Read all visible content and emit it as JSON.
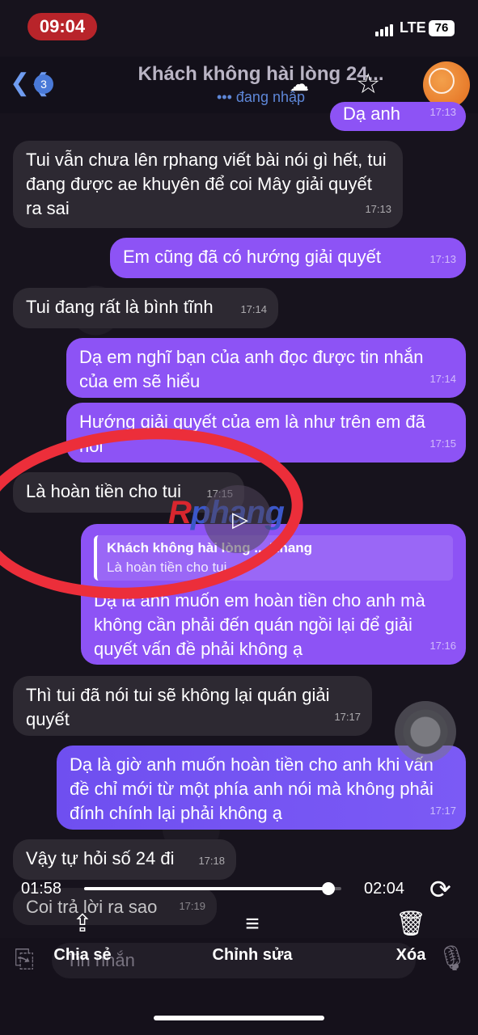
{
  "status_bar": {
    "time": "09:04",
    "network": "LTE",
    "battery": "76"
  },
  "header": {
    "back_count": "3",
    "title": "Khách không hài lòng 24...",
    "status": "đang nhập"
  },
  "messages": [
    {
      "text": "Dạ anh",
      "time": "17:13"
    },
    {
      "text": "Tui vẫn chưa lên rphang viết bài nói gì hết, tui đang được ae khuyên để coi Mây giải quyết ra sai",
      "time": "17:13"
    },
    {
      "text": "Em cũng đã có hướng giải quyết",
      "time": "17:13"
    },
    {
      "text": "Tui đang rất là bình tĩnh",
      "time": "17:14"
    },
    {
      "text": "Dạ em nghĩ bạn của anh đọc được tin nhắn của em sẽ hiểu",
      "time": "17:14"
    },
    {
      "text": "Hướng giải quyết của em là như trên em đã nói",
      "time": "17:15"
    },
    {
      "text": "Là hoàn tiền cho tui",
      "time": "17:15"
    },
    {
      "reply_name": "Khách không hài lòng ... Khang",
      "reply_text": "Là hoàn tiền cho tui",
      "text": "Dạ là anh muốn em hoàn tiền cho anh mà không cần phải đến quán ngồi lại để giải quyết vấn đề phải không ạ",
      "time": "17:16"
    },
    {
      "text": "Thì tui đã nói tui sẽ không lại quán giải quyết",
      "time": "17:17"
    },
    {
      "text": "Dạ là giờ anh muốn hoàn tiền cho anh khi vấn đề chỉ mới từ một phía anh nói mà không phải đính chính lại phải không ạ",
      "time": "17:17"
    },
    {
      "text": "Vậy tự hỏi số 24 đi",
      "time": "17:18"
    },
    {
      "text": "Coi trả lời ra sao",
      "time": "17:19"
    }
  ],
  "watermark": {
    "first": "R",
    "rest": "phang"
  },
  "player": {
    "elapsed": "01:58",
    "total": "02:04",
    "progress": 0.95
  },
  "input": {
    "placeholder": "Tin nhắn"
  },
  "actions": {
    "share": "Chia sẻ",
    "edit": "Chỉnh sửa",
    "delete": "Xóa"
  },
  "icons": [
    "back-icon",
    "upload-cloud-icon",
    "star-icon",
    "play-icon",
    "repeat-icon",
    "share-icon",
    "sliders-icon",
    "trash-icon",
    "paperclip-icon",
    "mic-icon"
  ],
  "colors": {
    "outgoing": "#8d53f5",
    "incoming": "#2d2932",
    "annotation": "#ec2e3a",
    "time_pill": "#b8242a"
  }
}
